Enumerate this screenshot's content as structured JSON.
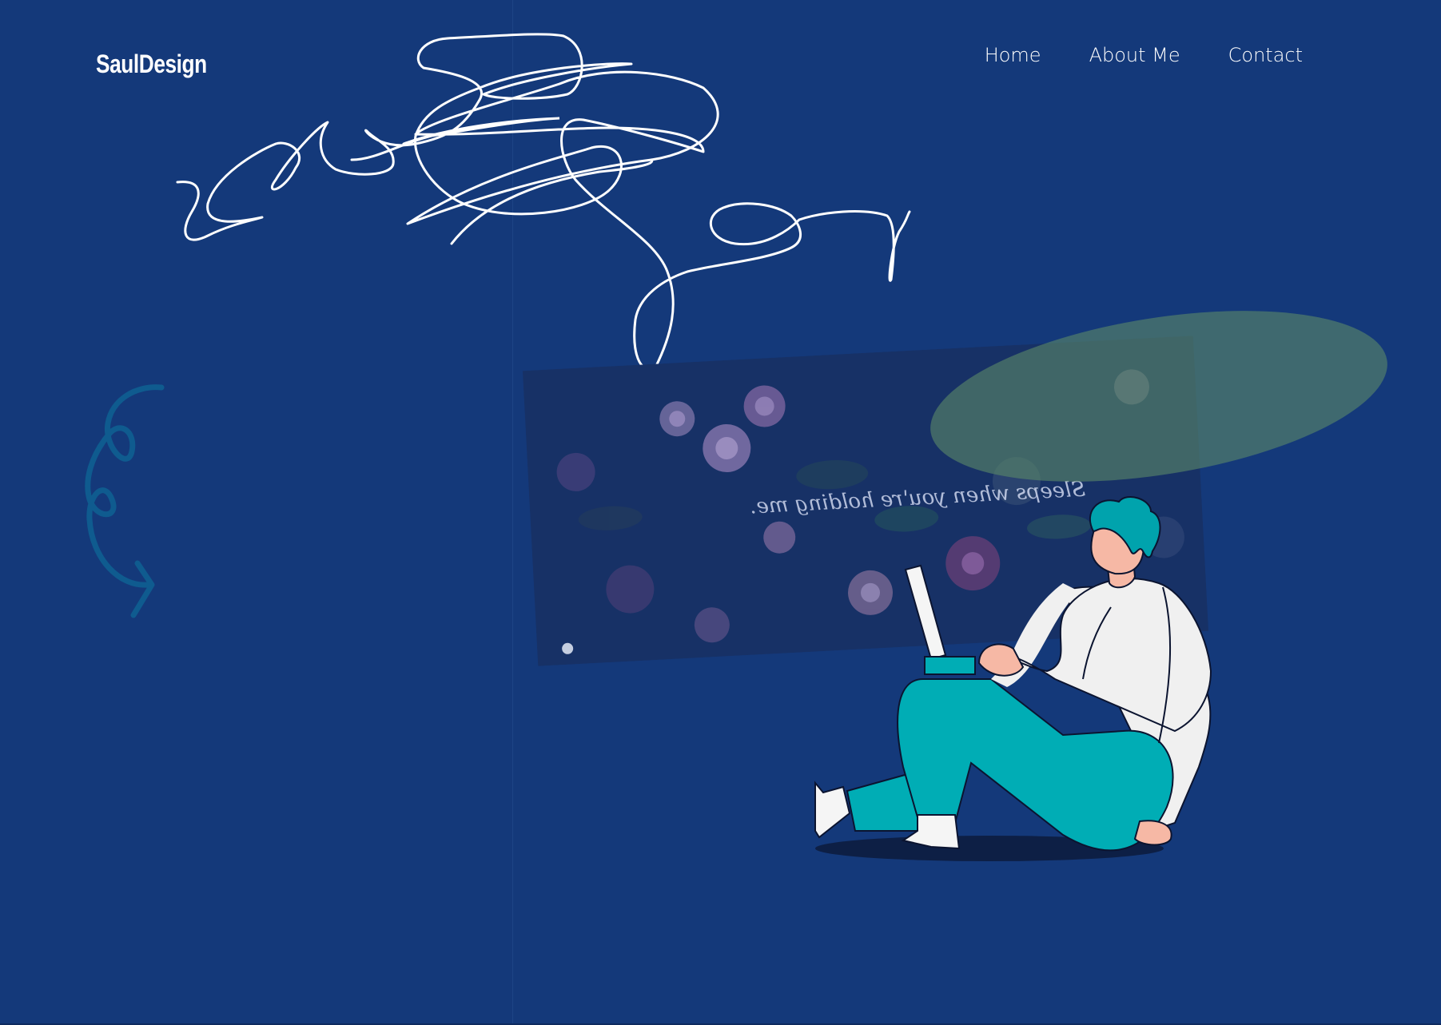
{
  "brand": {
    "logo_text": "SaulDesign"
  },
  "nav": {
    "items": [
      {
        "label": "Home"
      },
      {
        "label": "About Me"
      },
      {
        "label": "Contact"
      }
    ]
  },
  "hero": {
    "photo_overlay_text": "Sleeps when you're holding me.",
    "illustration": "person-sitting-with-laptop"
  },
  "colors": {
    "background": "#14397a",
    "accent_teal": "#00adb5",
    "ellipse_green": "#4a6e6b",
    "squiggle_blue": "#0f5b8f"
  }
}
